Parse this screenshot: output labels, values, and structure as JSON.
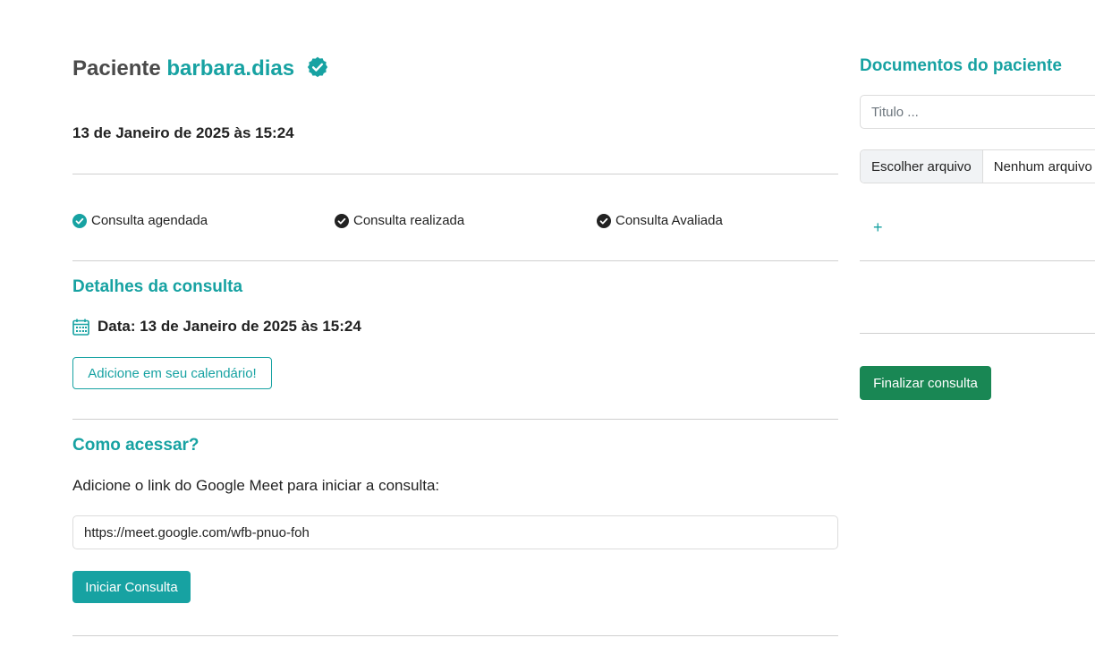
{
  "header": {
    "title_prefix": "Paciente",
    "patient_name": "barbara.dias",
    "verified_icon": "badge-check-icon",
    "appointment_datetime": "13 de Janeiro de 2025 às 15:24"
  },
  "statuses": [
    {
      "label": "Consulta agendada",
      "icon": "check-circle-icon",
      "color": "#17a2a2"
    },
    {
      "label": "Consulta realizada",
      "icon": "check-circle-icon",
      "color": "#222222"
    },
    {
      "label": "Consulta Avaliada",
      "icon": "check-circle-icon",
      "color": "#222222"
    }
  ],
  "details": {
    "heading": "Detalhes da consulta",
    "date_text": "Data: 13 de Janeiro de 2025 às 15:24",
    "calendar_icon": "calendar-icon",
    "add_calendar_label": "Adicione em seu calendário!"
  },
  "access": {
    "heading": "Como acessar?",
    "instructions": "Adicione o link do Google Meet para iniciar a consulta:",
    "meet_link": "https://meet.google.com/wfb-pnuo-foh",
    "start_label": "Iniciar Consulta"
  },
  "documents": {
    "heading": "Documentos do paciente",
    "title_placeholder": "Titulo ...",
    "choose_file_label": "Escolher arquivo",
    "no_file_label": "Nenhum arquivo escolhido",
    "add_label": "+"
  },
  "finish_label": "Finalizar consulta",
  "colors": {
    "accent": "#17a2a2",
    "success": "#198754",
    "text": "#212529"
  }
}
